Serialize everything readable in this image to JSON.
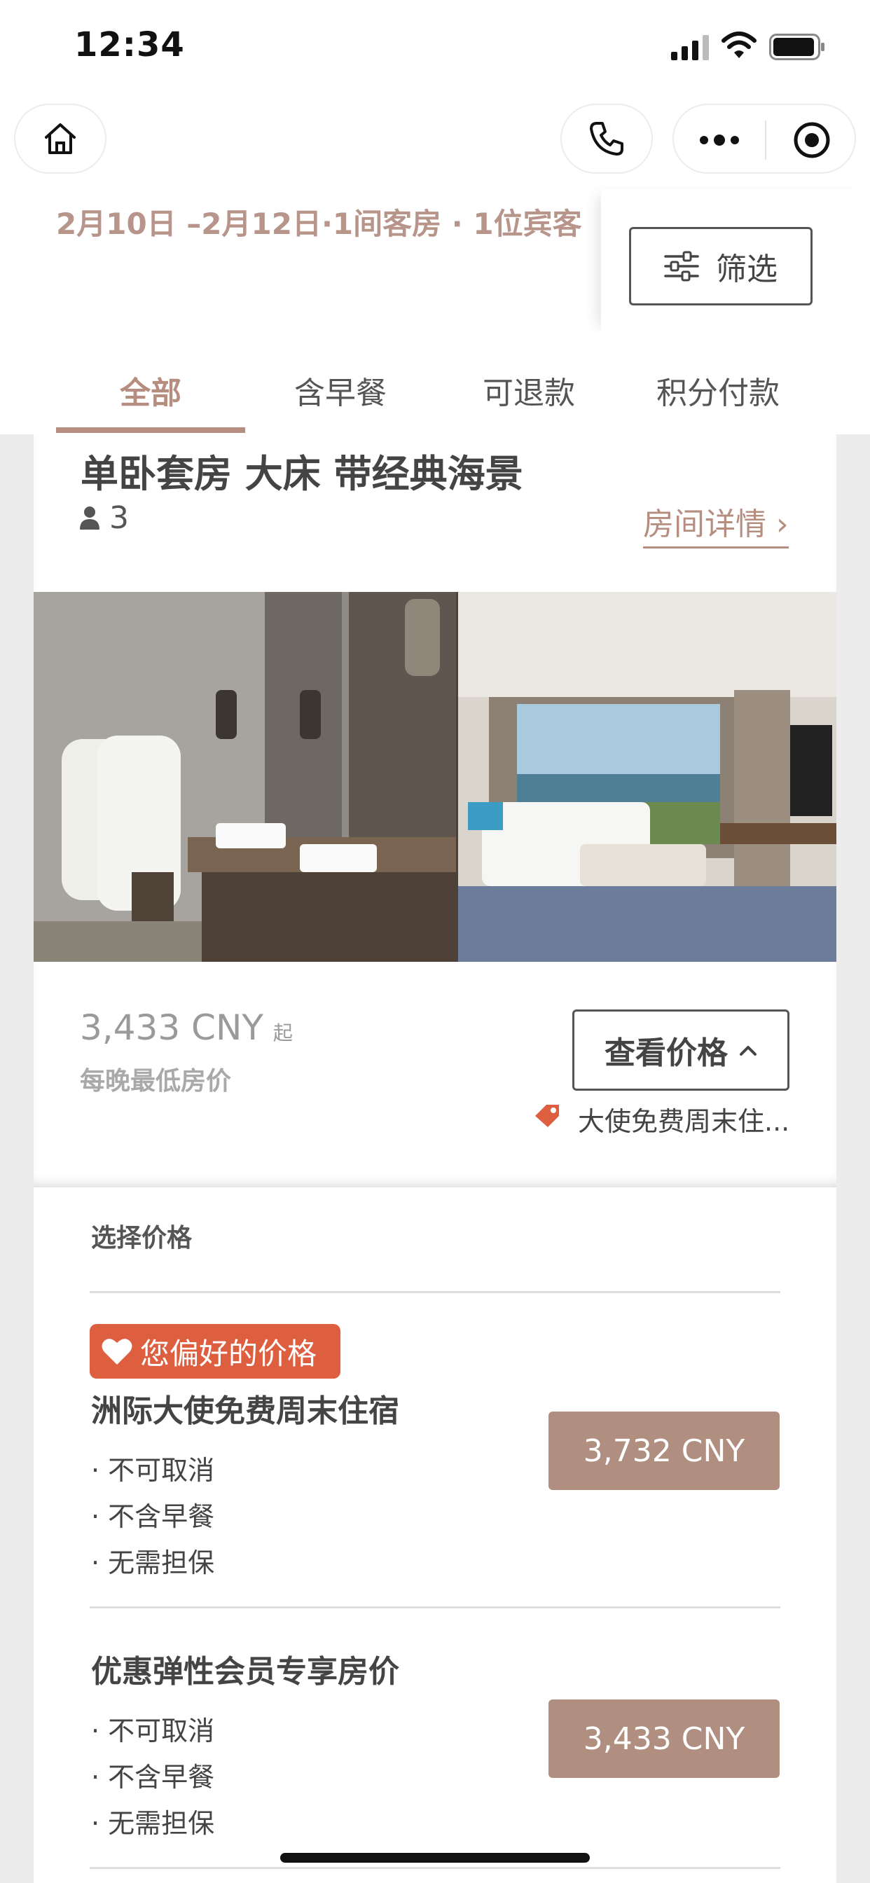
{
  "status_bar": {
    "time": "12:34"
  },
  "nav": {
    "home_icon": "home-icon",
    "phone_icon": "phone-icon",
    "more_icon": "more-dots-icon",
    "close_icon": "target-circle-icon"
  },
  "search": {
    "summary": "2月10日 –2月12日·1间客房 · 1位宾客",
    "filter_label": "筛选"
  },
  "tabs": [
    "全部",
    "含早餐",
    "可退款",
    "积分付款"
  ],
  "room": {
    "title": "单卧套房 大床 带经典海景",
    "guests": "3",
    "detail_link": "房间详情 ›",
    "price": "3,433 CNY",
    "price_from": "起",
    "price_sub": "每晚最低房价",
    "view_price_label": "查看价格",
    "promo": "大使免费周末住..."
  },
  "rates": {
    "heading": "选择价格",
    "preferred_label": "您偏好的价格",
    "items": [
      {
        "name": "洲际大使免费周末住宿",
        "features": [
          "· 不可取消",
          "· 不含早餐",
          "· 无需担保"
        ],
        "price": "3,732 CNY"
      },
      {
        "name": "优惠弹性会员专享房价",
        "features": [
          "· 不可取消",
          "· 不含早餐",
          "· 无需担保"
        ],
        "price": "3,433 CNY"
      }
    ]
  },
  "colors": {
    "accent": "#b58e80",
    "badge": "#dd5f40",
    "rate_button": "#b08e80"
  }
}
